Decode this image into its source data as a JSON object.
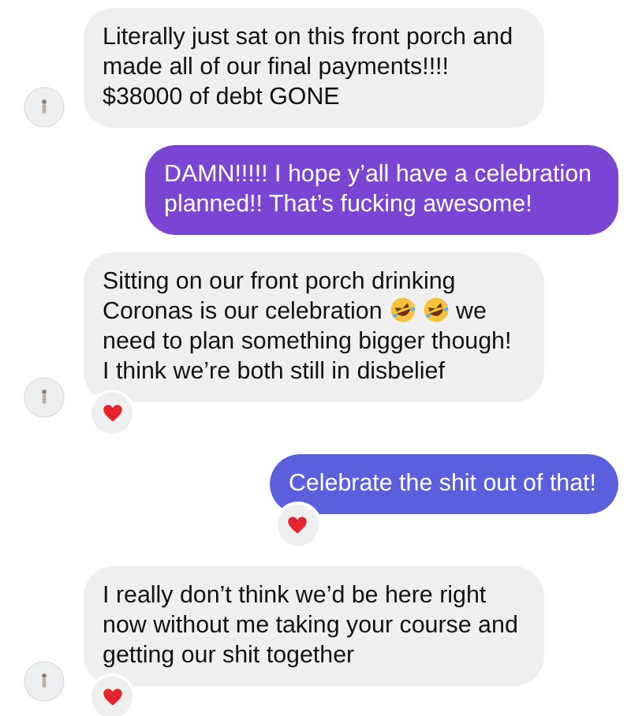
{
  "messages": [
    {
      "outgoing": false,
      "avatar": true,
      "parts": [
        {
          "kind": "line",
          "text": "Literally just sat on this front porch and made all of our final payments!!!! $38000 of debt GONE"
        }
      ],
      "heart_reaction": false
    },
    {
      "outgoing": true,
      "color": "#7b45d3",
      "parts": [
        {
          "kind": "line",
          "text": "DAMN!!!!! I hope y’all have a celebration planned!! That’s fucking awesome!"
        }
      ],
      "heart_reaction": false
    },
    {
      "outgoing": false,
      "avatar": true,
      "parts": [
        {
          "kind": "line",
          "text": "Sitting on our front porch drinking"
        },
        {
          "kind": "text",
          "text": "Coronas is our celebration"
        },
        {
          "kind": "emoji"
        },
        {
          "kind": "emoji"
        },
        {
          "kind": "text",
          "text": "we"
        },
        {
          "kind": "line",
          "text": "need to plan something bigger though! I think we’re both still in disbelief"
        }
      ],
      "heart_reaction": true
    },
    {
      "outgoing": true,
      "color": "#5a5fdd",
      "parts": [
        {
          "kind": "line",
          "text": "Celebrate the shit out of that!"
        }
      ],
      "heart_reaction": true
    },
    {
      "outgoing": false,
      "avatar": true,
      "parts": [
        {
          "kind": "line",
          "text": "I really don’t think we’d be here right now without me taking your course and getting our shit together"
        }
      ],
      "heart_reaction": true
    }
  ]
}
